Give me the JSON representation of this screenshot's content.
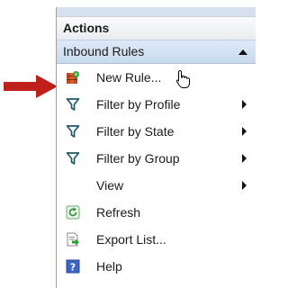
{
  "panel": {
    "title": "Actions",
    "section": {
      "label": "Inbound Rules"
    },
    "items": [
      {
        "label": "New Rule...",
        "icon": "new-rule-icon"
      },
      {
        "label": "Filter by Profile",
        "icon": "filter-icon"
      },
      {
        "label": "Filter by State",
        "icon": "filter-icon"
      },
      {
        "label": "Filter by Group",
        "icon": "filter-icon"
      },
      {
        "label": "View",
        "icon": ""
      },
      {
        "label": "Refresh",
        "icon": "refresh-icon"
      },
      {
        "label": "Export List...",
        "icon": "export-list-icon"
      },
      {
        "label": "Help",
        "icon": "help-icon"
      }
    ]
  },
  "colors": {
    "pointer_arrow": "#c0201a",
    "section_bg": "#d4e2f4",
    "filter_icon": "#1e5a6a"
  }
}
